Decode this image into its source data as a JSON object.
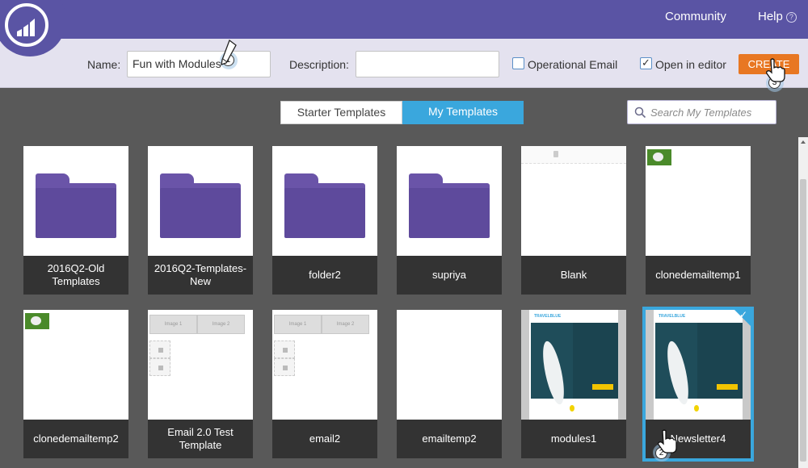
{
  "header": {
    "community_label": "Community",
    "help_label": "Help",
    "help_icon": "question-circle-icon",
    "brand_color": "#5a54a4"
  },
  "form": {
    "name_label": "Name:",
    "name_value": "Fun with Modules",
    "description_label": "Description:",
    "description_value": "",
    "operational_email_label": "Operational Email",
    "operational_email_checked": false,
    "open_in_editor_label": "Open in editor",
    "open_in_editor_checked": true,
    "create_label": "CREATE",
    "create_color": "#e87722"
  },
  "steps": [
    "1",
    "2",
    "3"
  ],
  "tabs": {
    "starter_label": "Starter Templates",
    "my_label": "My Templates",
    "active": "My Templates",
    "active_color": "#3aa7dd"
  },
  "search": {
    "placeholder": "Search My Templates"
  },
  "templates": [
    {
      "name": "2016Q2-Old Templates",
      "kind": "folder"
    },
    {
      "name": "2016Q2-Templates-New",
      "kind": "folder"
    },
    {
      "name": "folder2",
      "kind": "folder"
    },
    {
      "name": "supriya",
      "kind": "folder"
    },
    {
      "name": "Blank",
      "kind": "template"
    },
    {
      "name": "clonedemailtemp1",
      "kind": "template"
    },
    {
      "name": "clonedemailtemp2",
      "kind": "template"
    },
    {
      "name": "Email 2.0 Test Template",
      "kind": "template"
    },
    {
      "name": "email2",
      "kind": "template"
    },
    {
      "name": "emailtemp2",
      "kind": "template"
    },
    {
      "name": "modules1",
      "kind": "template"
    },
    {
      "name": "Newsletter4",
      "kind": "template",
      "selected": true
    }
  ],
  "thumbnails": {
    "image1": "Image 1",
    "image2": "Image 2",
    "brand": "TRAVELBLUE"
  }
}
